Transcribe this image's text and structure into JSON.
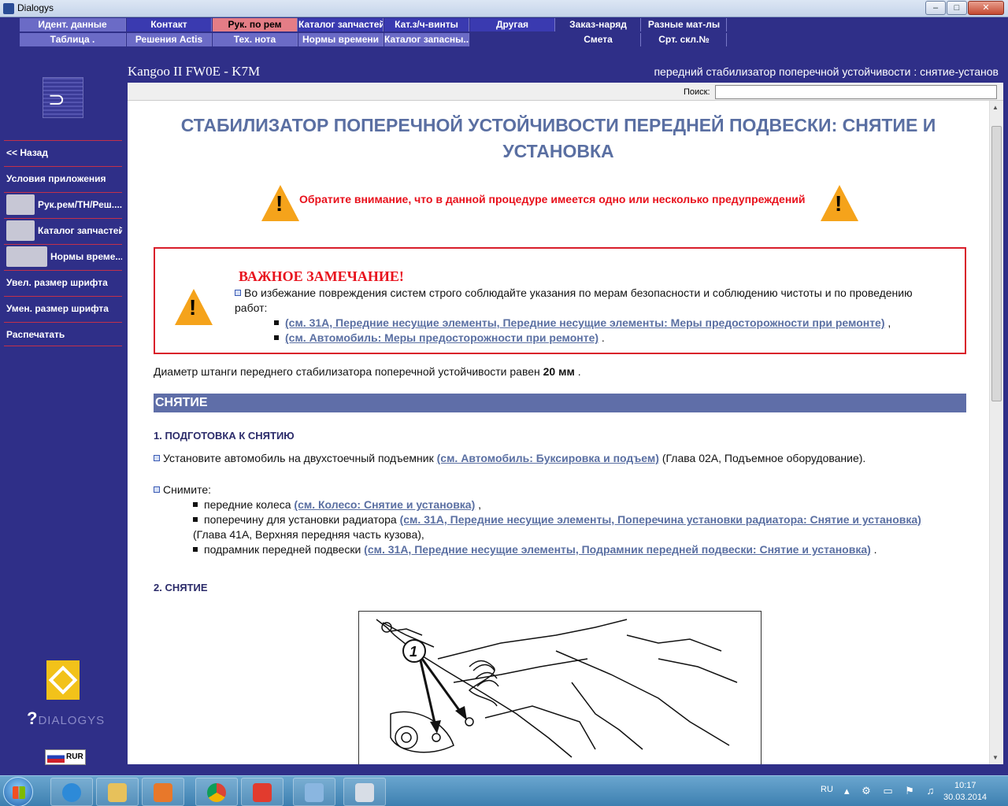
{
  "window": {
    "title": "Dialogys",
    "minimize": "‒",
    "maximize": "□",
    "close": "✕"
  },
  "top_menu": {
    "row1": [
      "Идент. данные",
      "Контакт",
      "Рук. по рем",
      "Каталог запчастей",
      "Кат.з/ч-винты",
      "Другая",
      "Заказ-наряд",
      "Разные мат-лы"
    ],
    "row2": [
      "Таблица .",
      "Решения Actis",
      "Тех. нота",
      "Нормы времени",
      "Каталог запасны...",
      "Смета",
      "Срт. скл.№"
    ]
  },
  "sidebar": {
    "items": [
      "<< Назад",
      "Условия приложения",
      "Рук.рем/ТН/Реш....",
      "Каталог запчастей",
      "Нормы време...",
      "Увел. размер шрифта",
      "Умен. размер шрифта",
      "Распечатать"
    ],
    "logo_text": "DIALOGYS",
    "lang": "RUR"
  },
  "header": {
    "vehicle": "Kangoo II FW0E - K7M",
    "breadcrumb": "передний стабилизатор поперечной устойчивости : снятие-установ"
  },
  "search": {
    "label": "Поиск:",
    "value": ""
  },
  "document": {
    "title": "СТАБИЛИЗАТОР ПОПЕРЕЧНОЙ УСТОЙЧИВОСТИ ПЕРЕДНЕЙ ПОДВЕСКИ: СНЯТИЕ И УСТАНОВКА",
    "warning_note": "Обратите внимание, что в данной процедуре имеется одно или несколько предупреждений",
    "important": {
      "title": "ВАЖНОЕ ЗАМЕЧАНИЕ!",
      "text": "Во избежание повреждения систем строго соблюдайте указания по мерам безопасности и соблюдению чистоты и по проведению работ:",
      "link1": "(см. 31A, Передние несущие элементы, Передние несущие элементы: Меры предосторожности при ремонте)",
      "link1_suffix": " ,",
      "link2": "(см. Автомобиль: Меры предосторожности при ремонте)",
      "link2_suffix": " ."
    },
    "diameter": {
      "text": "Диаметр штанги переднего стабилизатора поперечной устойчивости равен ",
      "value": "20 мм",
      "suffix": " ."
    },
    "section": "СНЯТИЕ",
    "step1": {
      "heading": "1. ПОДГОТОВКА К СНЯТИЮ",
      "text": "Установите автомобиль на двухстоечный подъемник ",
      "link": "(см. Автомобиль: Буксировка и подъем)",
      "suffix": " (Глава 02A, Подъемное оборудование)."
    },
    "remove": {
      "label": "Снимите:",
      "item1_text": "передние колеса ",
      "item1_link": "(см. Колесо: Снятие и установка)",
      "item1_suffix": " ,",
      "item2_text": "поперечину для установки радиатора ",
      "item2_link": "(см. 31A, Передние несущие элементы, Поперечина установки радиатора: Снятие и установка)",
      "item2_cont": "(Глава 41A, Верхняя передняя часть кузова),",
      "item3_text": "подрамник передней подвески ",
      "item3_link": "(см. 31A, Передние несущие элементы, Подрамник передней подвески: Снятие и установка)",
      "item3_suffix": " ."
    },
    "step2": {
      "heading": "2. СНЯТИЕ"
    },
    "figure": {
      "callout": "1"
    }
  },
  "taskbar": {
    "lang": "RU",
    "time": "10:17",
    "date": "30.03.2014"
  },
  "colors": {
    "background": "#2f2f88",
    "menu": "#3a3ab0",
    "menu_active": "#e47d86",
    "title_blue": "#5a6fa2",
    "warning_red": "#e8111c",
    "section_bar": "#5f6ea8"
  }
}
